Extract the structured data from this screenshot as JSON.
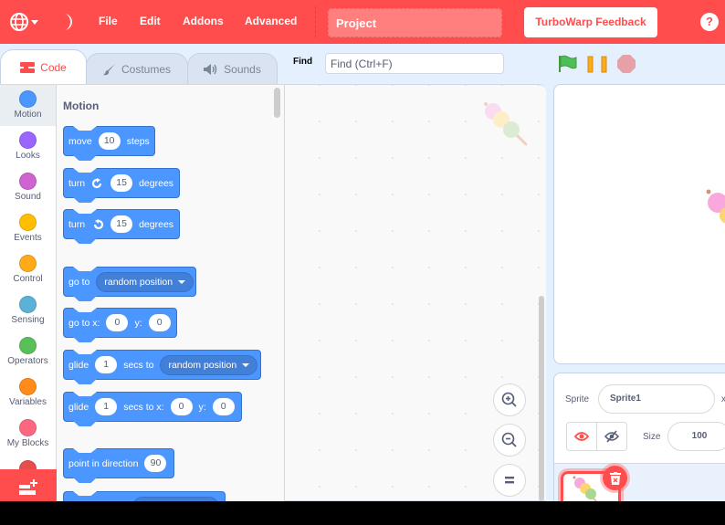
{
  "menubar": {
    "items": [
      "File",
      "Edit",
      "Addons",
      "Advanced"
    ],
    "project_title": "Project",
    "feedback_label": "TurboWarp Feedback",
    "help_label": "?",
    "language_icon": "globe-icon",
    "theme_icon": "moon-icon"
  },
  "tabs": [
    {
      "label": "Code",
      "icon": "code-icon",
      "active": true
    },
    {
      "label": "Costumes",
      "icon": "brush-icon",
      "active": false
    },
    {
      "label": "Sounds",
      "icon": "speaker-icon",
      "active": false
    }
  ],
  "find": {
    "label": "Find",
    "placeholder": "Find (Ctrl+F)",
    "value": ""
  },
  "controls": {
    "green_flag": "green-flag-icon",
    "pause": "pause-icon",
    "stop": "stop-icon"
  },
  "categories": [
    {
      "label": "Motion",
      "color": "#4c97ff",
      "selected": true
    },
    {
      "label": "Looks",
      "color": "#9966ff"
    },
    {
      "label": "Sound",
      "color": "#cf63cf"
    },
    {
      "label": "Events",
      "color": "#ffbf00"
    },
    {
      "label": "Control",
      "color": "#ffab19"
    },
    {
      "label": "Sensing",
      "color": "#5cb1d6"
    },
    {
      "label": "Operators",
      "color": "#59c059"
    },
    {
      "label": "Variables",
      "color": "#ff8c1a"
    },
    {
      "label": "My Blocks",
      "color": "#ff6680"
    },
    {
      "label": "",
      "color": "#e64d4d"
    }
  ],
  "flyout": {
    "title": "Motion",
    "blocks": {
      "move": {
        "a": "move",
        "n": "10",
        "b": "steps"
      },
      "turn_right": {
        "a": "turn",
        "n": "15",
        "b": "degrees"
      },
      "turn_left": {
        "a": "turn",
        "n": "15",
        "b": "degrees"
      },
      "goto": {
        "a": "go to",
        "dd": "random position"
      },
      "goto_xy": {
        "a": "go to x:",
        "x": "0",
        "b": "y:",
        "y": "0"
      },
      "glide": {
        "a": "glide",
        "n": "1",
        "b": "secs to",
        "dd": "random position"
      },
      "glide_xy": {
        "a": "glide",
        "n": "1",
        "b": "secs to x:",
        "x": "0",
        "c": "y:",
        "y": "0"
      },
      "point": {
        "a": "point in direction",
        "n": "90"
      }
    }
  },
  "sprite_info": {
    "sprite_label": "Sprite",
    "sprite_name": "Sprite1",
    "x_label": "x",
    "size_label": "Size",
    "size_value": "100"
  }
}
